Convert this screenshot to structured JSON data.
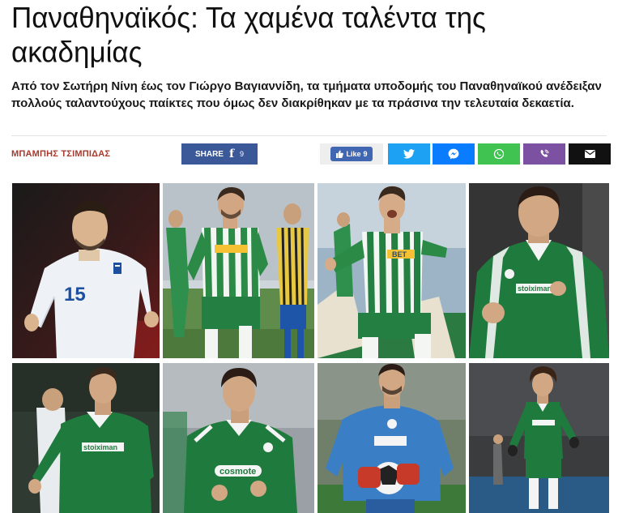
{
  "article": {
    "title": "Παναθηναϊκός: Τα χαμένα ταλέντα της ακαδημίας",
    "lead": "Από τον Σωτήρη Νίνη έως τον Γιώργο Βαγιαννίδη, τα τμήματα υποδομής του Παναθηναϊκού ανέδειξαν πολλούς ταλαντούχους παίκτες που όμως δεν διακρίθηκαν με τα πράσινα την τελευταία δεκαετία.",
    "author": "ΜΠΑΜΠΗΣ ΤΣΙΜΠΙΔΑΣ"
  },
  "share": {
    "share_label": "SHARE",
    "share_count": "9",
    "like_label": "Like",
    "like_count": "9"
  },
  "colors": {
    "facebook": "#3b5998",
    "twitter": "#1da1f2",
    "messenger": "#0a7cff",
    "whatsapp": "#40c351",
    "viber": "#7d51a1",
    "email": "#111111",
    "author": "#a63a2c",
    "panathinaikos_green": "#1f7a3e"
  },
  "photos": {
    "p1": {
      "shirt_number": "15"
    },
    "p3": {
      "sponsor": "BET"
    },
    "p4": {
      "sponsor": "stoiximan"
    },
    "p5": {
      "sponsor": "stoiximan"
    },
    "p6": {
      "sponsor": "cosmote"
    }
  }
}
